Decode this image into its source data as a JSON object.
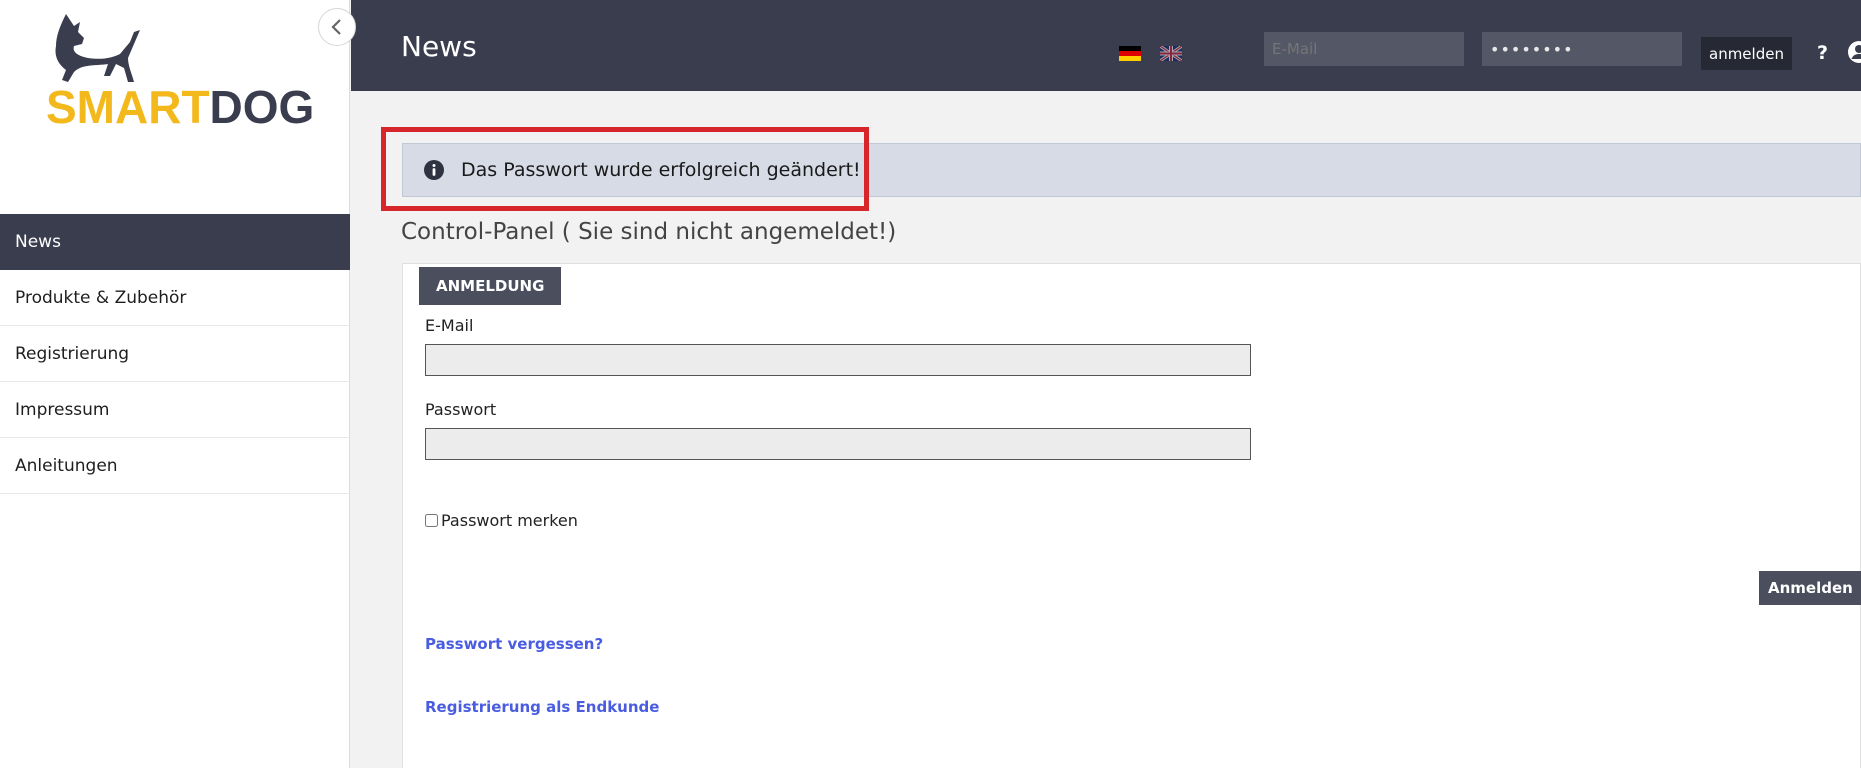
{
  "brand": {
    "logo_text_smart": "SMART",
    "logo_text_dog": "DOG",
    "colors": {
      "yellow": "#f2b81c",
      "dark": "#3a3d4d"
    }
  },
  "sidebar": {
    "collapse_icon": "chevron-left-icon",
    "items": [
      {
        "label": "News",
        "active": true
      },
      {
        "label": "Produkte & Zubehör",
        "active": false
      },
      {
        "label": "Registrierung",
        "active": false
      },
      {
        "label": "Impressum",
        "active": false
      },
      {
        "label": "Anleitungen",
        "active": false
      }
    ]
  },
  "header": {
    "title": "News",
    "languages": [
      "de-flag-icon",
      "en-flag-icon"
    ],
    "email_placeholder": "E-Mail",
    "password_value": "••••••••",
    "login_label": "anmelden",
    "help_label": "?",
    "user_icon": "user-icon"
  },
  "alert": {
    "icon": "info-icon",
    "text": "Das Passwort wurde erfolgreich geändert!",
    "highlight_color": "#d6262b"
  },
  "panel": {
    "title": "Control-Panel ( Sie sind nicht angemeldet!)",
    "tab_label": "ANMELDUNG",
    "email_label": "E-Mail",
    "email_value": "",
    "password_label": "Passwort",
    "password_value": "",
    "remember_label": "Passwort merken",
    "remember_checked": false,
    "submit_label": "Anmelden",
    "forgot_link": "Passwort vergessen?",
    "register_link": "Registrierung als Endkunde"
  }
}
